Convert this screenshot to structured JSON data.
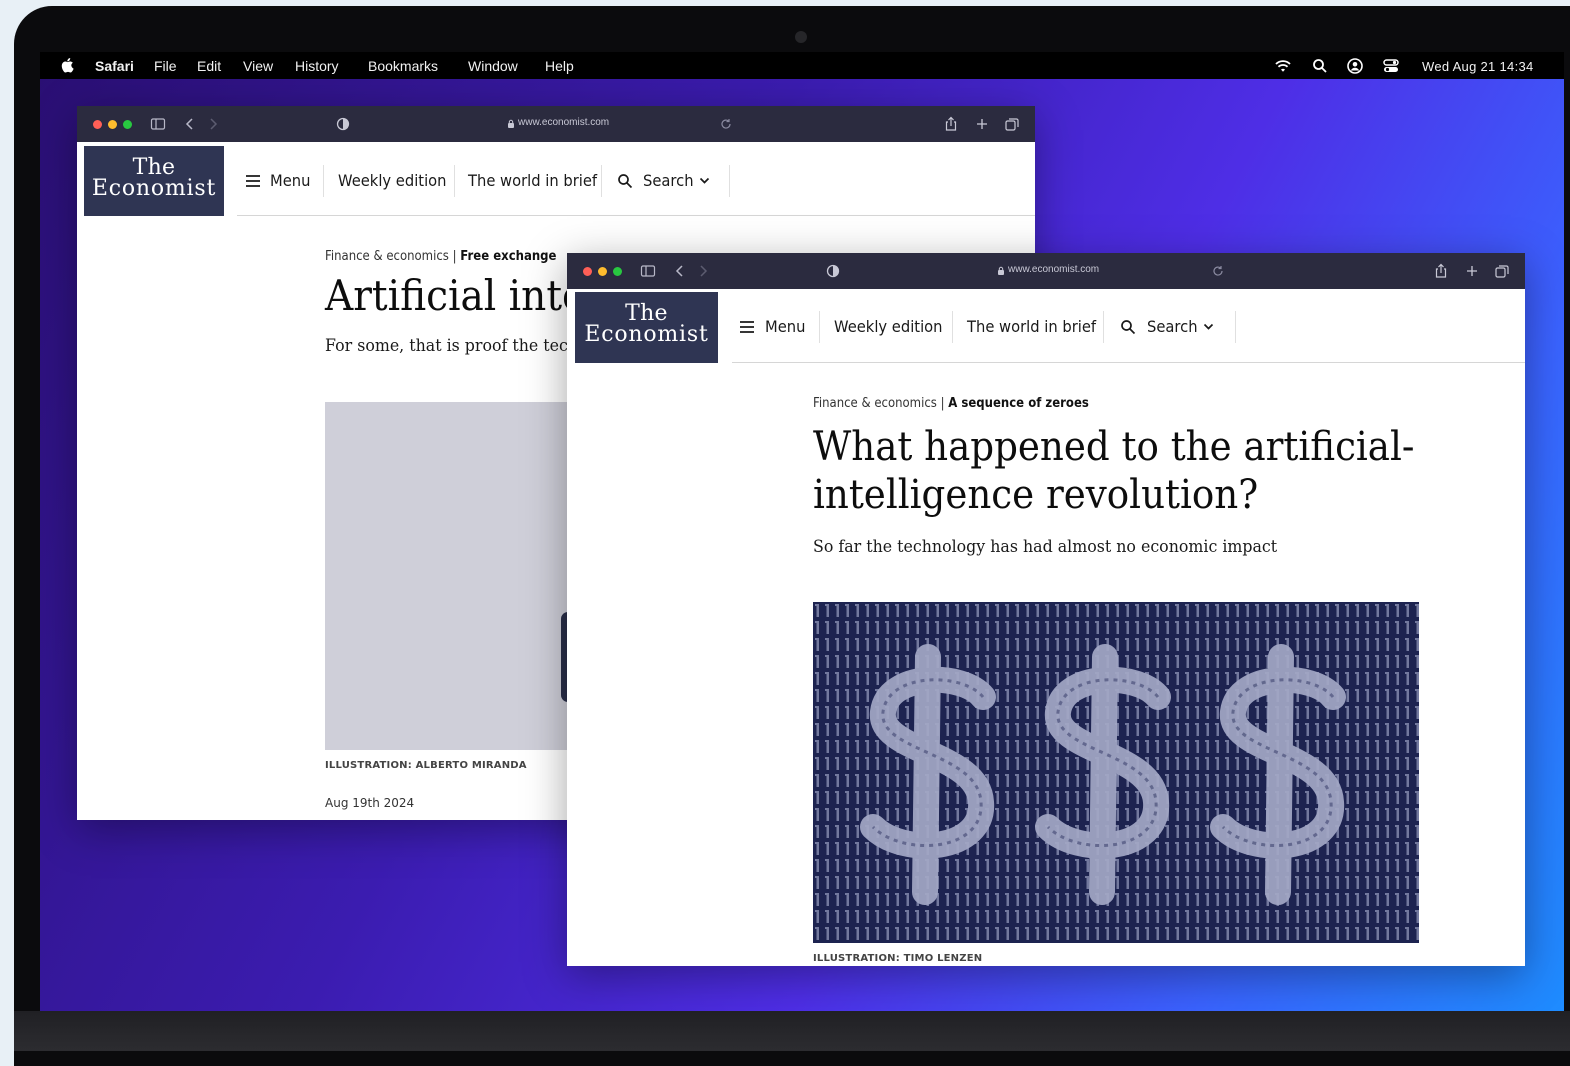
{
  "menubar": {
    "app_name": "Safari",
    "items": [
      "File",
      "Edit",
      "View",
      "History",
      "Bookmarks",
      "Window",
      "Help"
    ],
    "clock": "Wed Aug 21  14:34"
  },
  "back_window": {
    "url": "www.economist.com",
    "logo_line1": "The",
    "logo_line2": "Economist",
    "nav": {
      "menu": "Menu",
      "weekly": "Weekly edition",
      "world": "The world in brief",
      "search": "Search"
    },
    "kicker_section": "Finance & economics",
    "kicker_sep": " | ",
    "kicker_topic": "Free exchange",
    "headline": "Artificial intelligence is losing hype",
    "standfirst": "For some, that is proof the tech will in time succeed",
    "caption": "ILLUSTRATION: ALBERTO MIRANDA",
    "date": "Aug 19th 2024"
  },
  "front_window": {
    "url": "www.economist.com",
    "logo_line1": "The",
    "logo_line2": "Economist",
    "nav": {
      "menu": "Menu",
      "weekly": "Weekly edition",
      "world": "The world in brief",
      "search": "Search"
    },
    "kicker_section": "Finance & economics",
    "kicker_sep": " | ",
    "kicker_topic": "A sequence of zeroes",
    "headline_line1": "What happened to the artificial-",
    "headline_line2": "intelligence revolution?",
    "standfirst": "So far the technology has had almost no economic impact",
    "caption": "ILLUSTRATION: TIMO LENZEN"
  },
  "colors": {
    "logo_bg": "#2f3553",
    "toolbar_bg": "#2b2b3f",
    "traffic_red": "#ff5f57",
    "traffic_yellow": "#febc2e",
    "traffic_green": "#28c840",
    "illustration_bg": "#1d2350"
  }
}
